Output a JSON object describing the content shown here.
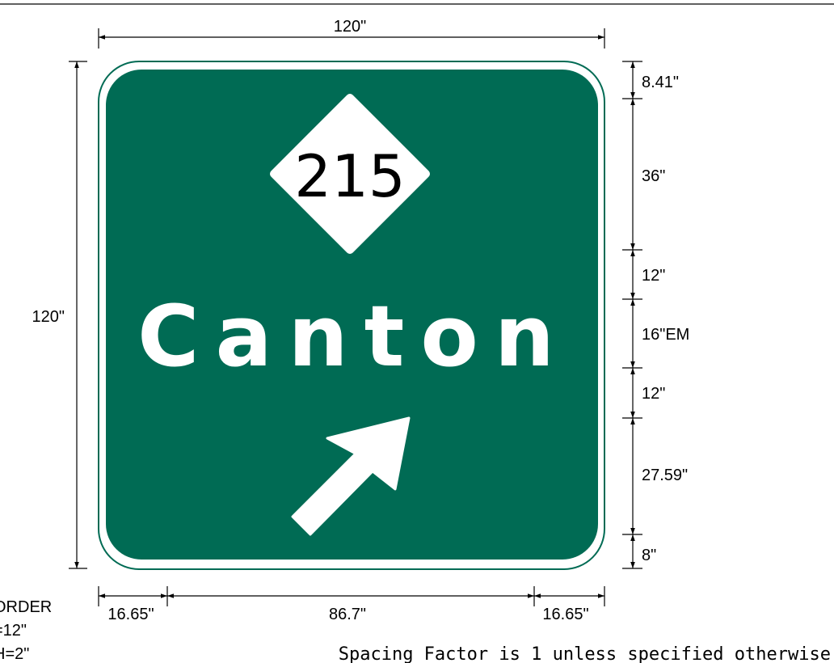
{
  "sign": {
    "background_color": "#006b54",
    "legend_color": "#ffffff",
    "route_shield": {
      "number": "215",
      "shape": "diamond",
      "text_color": "#000000"
    },
    "destination": "Canton",
    "arrow": "up-right-arrow"
  },
  "dimensions": {
    "top_width": "120\"",
    "left_height": "120\"",
    "right": [
      "8.41\"",
      "36\"",
      "12\"",
      "16\"EM",
      "12\"",
      "27.59\"",
      "8\""
    ],
    "bottom": [
      "16.65\"",
      "86.7\"",
      "16.65\""
    ]
  },
  "border_note": [
    "ORDER",
    "=12\"",
    "H=2\""
  ],
  "spacing_note": "Spacing Factor is 1 unless specified otherwise"
}
